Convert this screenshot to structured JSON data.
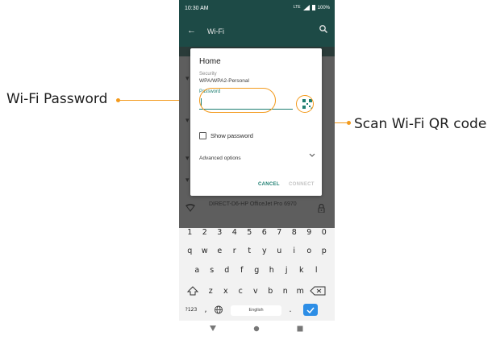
{
  "callouts": {
    "wifi_password": "Wi-Fi Password",
    "scan_qr": "Scan Wi-Fi QR code"
  },
  "status_bar": {
    "time": "10:30 AM",
    "network": "LTE",
    "battery": "100%"
  },
  "app_bar": {
    "title": "Wi-Fi",
    "back_icon": "arrow-back-icon",
    "search_icon": "search-icon"
  },
  "dialog": {
    "title": "Home",
    "security_label": "Security",
    "security_value": "WPA/WPA2-Personal",
    "password_label": "Password",
    "password_value": "",
    "qr_icon": "qr-code-scan-icon",
    "show_password_label": "Show password",
    "show_password_checked": false,
    "advanced_label": "Advanced options",
    "cancel_label": "CANCEL",
    "connect_label": "CONNECT"
  },
  "networks": [
    {
      "name": "DIRECT-D6-HP OfficeJet Pro 6970",
      "icon": "wifi-signal-icon",
      "secured": true
    }
  ],
  "keyboard": {
    "number_row": [
      "1",
      "2",
      "3",
      "4",
      "5",
      "6",
      "7",
      "8",
      "9",
      "0"
    ],
    "row1": [
      "q",
      "w",
      "e",
      "r",
      "t",
      "y",
      "u",
      "i",
      "o",
      "p"
    ],
    "row2": [
      "a",
      "s",
      "d",
      "f",
      "g",
      "h",
      "j",
      "k",
      "l"
    ],
    "row3": [
      "z",
      "x",
      "c",
      "v",
      "b",
      "n",
      "m"
    ],
    "symbols_key": "?123",
    "comma_key": ",",
    "period_key": ".",
    "space_label": "English"
  },
  "colors": {
    "accent": "#1f7f72",
    "header": "#1d4a46",
    "callout": "#f39a1c",
    "enter_key": "#2d8ee6"
  }
}
